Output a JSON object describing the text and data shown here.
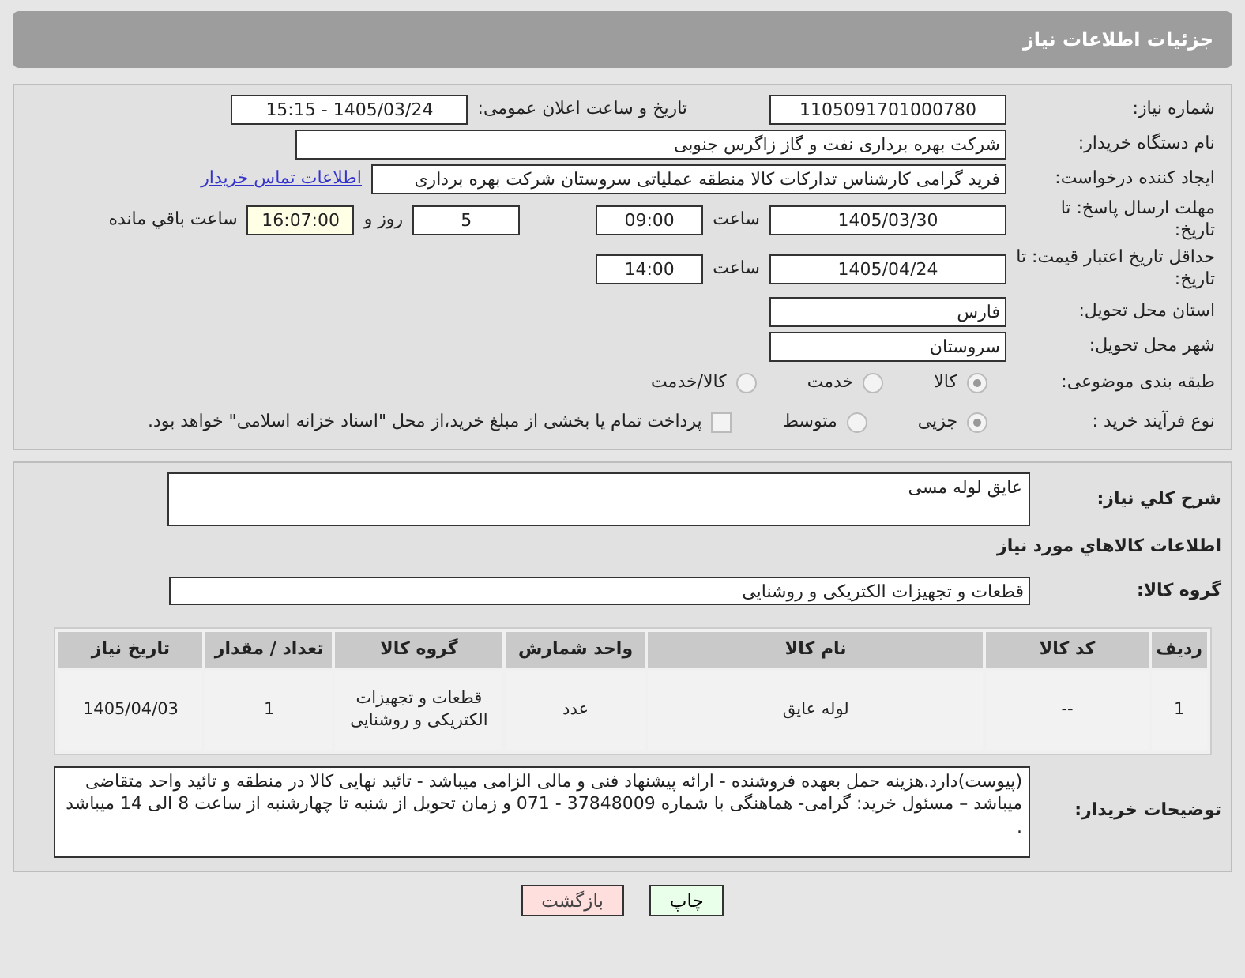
{
  "page_title": "جزئیات اطلاعات نیاز",
  "need_number": {
    "label": "شماره نیاز:",
    "value": "1105091701000780"
  },
  "announce": {
    "label": "تاریخ و ساعت اعلان عمومی:",
    "value": "1405/03/24 - 15:15"
  },
  "buyer_org": {
    "label": "نام دستگاه خریدار:",
    "value": "شرکت بهره برداری نفت و گاز زاگرس جنوبی"
  },
  "requester": {
    "label": "ایجاد کننده درخواست:",
    "value": "فرید گرامی کارشناس تدارکات کالا منطقه عملیاتی سروستان شرکت بهره برداری",
    "link": "اطلاعات تماس خریدار"
  },
  "response_deadline": {
    "label": "مهلت ارسال پاسخ: تا تاریخ:",
    "date": "1405/03/30",
    "time_label": "ساعت",
    "time": "09:00",
    "days": "5",
    "days_label": "روز و",
    "remaining": "16:07:00",
    "remaining_label": "ساعت باقي مانده"
  },
  "price_validity": {
    "label": "حداقل تاریخ اعتبار قیمت: تا تاریخ:",
    "date": "1405/04/24",
    "time_label": "ساعت",
    "time": "14:00"
  },
  "province": {
    "label": "استان محل تحویل:",
    "value": "فارس"
  },
  "city": {
    "label": "شهر محل تحویل:",
    "value": "سروستان"
  },
  "category": {
    "label": "طبقه بندی موضوعی:",
    "options": [
      {
        "label": "کالا",
        "selected": true
      },
      {
        "label": "خدمت",
        "selected": false
      },
      {
        "label": "کالا/خدمت",
        "selected": false
      }
    ]
  },
  "process": {
    "label": "نوع فرآیند خرید :",
    "options": [
      {
        "label": "جزیی",
        "selected": true
      },
      {
        "label": "متوسط",
        "selected": false
      }
    ],
    "payment": {
      "checked": false,
      "label": "پرداخت تمام یا بخشی از مبلغ خرید،از محل \"اسناد خزانه اسلامی\" خواهد بود."
    }
  },
  "description": {
    "label": "شرح کلي نياز:",
    "value": "عایق لوله مسی"
  },
  "goods_title": "اطلاعات کالاهاي مورد نياز",
  "goods_group": {
    "label": "گروه کالا:",
    "value": "قطعات و تجهیزات الکتریکی و روشنایی"
  },
  "table": {
    "columns": [
      "ردیف",
      "کد کالا",
      "نام کالا",
      "واحد شمارش",
      "گروه کالا",
      "تعداد / مقدار",
      "تاریخ نیاز"
    ],
    "rows": [
      [
        "1",
        "--",
        "لوله عایق",
        "عدد",
        "قطعات و تجهیزات الکتریکی و روشنایی",
        "1",
        "1405/04/03"
      ]
    ]
  },
  "buyer_notes": {
    "label": "توضیحات خریدار:",
    "value": "(پیوست)دارد.هزینه حمل بعهده فروشنده - ارائه پیشنهاد فنی و مالی الزامی میباشد - تائید نهایی کالا در منطقه و تائید واحد متقاضی میباشد – مسئول خرید: گرامی- هماهنگی با شماره 37848009 - 071 و زمان تحویل از شنبه تا چهارشنبه از ساعت 8 الی 14 میباشد ."
  },
  "buttons": [
    {
      "label": "چاپ",
      "kind": "print"
    },
    {
      "label": "بازگشت",
      "kind": "back"
    }
  ]
}
